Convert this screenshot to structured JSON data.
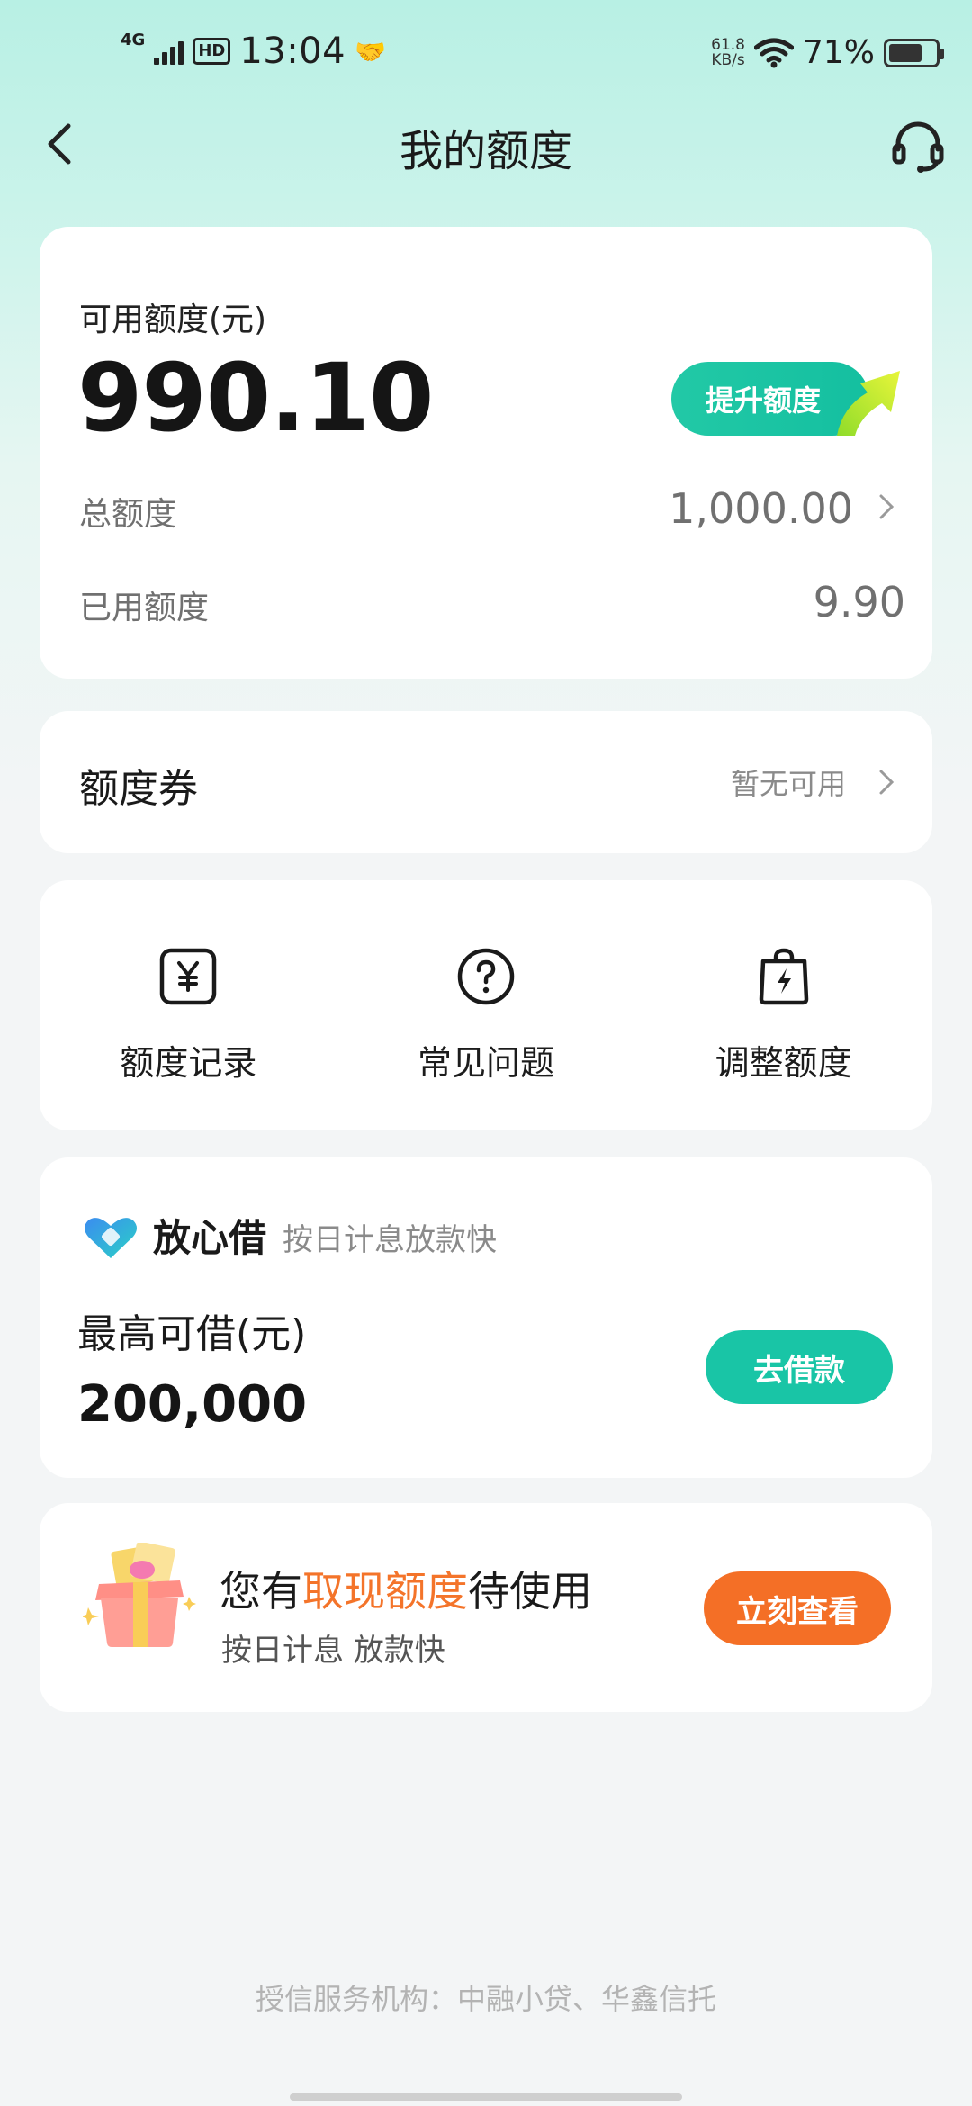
{
  "status_bar": {
    "network": "4G",
    "hd": "HD",
    "time": "13:04",
    "speed_value": "61.8",
    "speed_unit": "KB/s",
    "battery_percent": "71%",
    "battery_level": 0.71
  },
  "header": {
    "title": "我的额度"
  },
  "quota": {
    "available_label": "可用额度(元)",
    "available_amount": "990.10",
    "raise_button": "提升额度",
    "total_label": "总额度",
    "total_value": "1,000.00",
    "used_label": "已用额度",
    "used_value": "9.90"
  },
  "coupon": {
    "title": "额度券",
    "status": "暂无可用"
  },
  "actions": [
    {
      "label": "额度记录",
      "icon": "yuan-record-icon"
    },
    {
      "label": "常见问题",
      "icon": "question-icon"
    },
    {
      "label": "调整额度",
      "icon": "bolt-bag-icon"
    }
  ],
  "loan": {
    "brand": "放心借",
    "slogan": "按日计息放款快",
    "max_label": "最高可借(元)",
    "max_value": "200,000",
    "button": "去借款"
  },
  "cash": {
    "title_before": "您有",
    "title_highlight": "取现额度",
    "title_after": "待使用",
    "subtitle": "按日计息 放款快",
    "button": "立刻查看"
  },
  "footer": {
    "note": "授信服务机构：中融小贷、华鑫信托"
  },
  "colors": {
    "accent_teal": "#19c5a6",
    "accent_orange": "#f46f26",
    "header_gradient_top": "#b8f0e4",
    "page_background": "#f3f5f6"
  }
}
